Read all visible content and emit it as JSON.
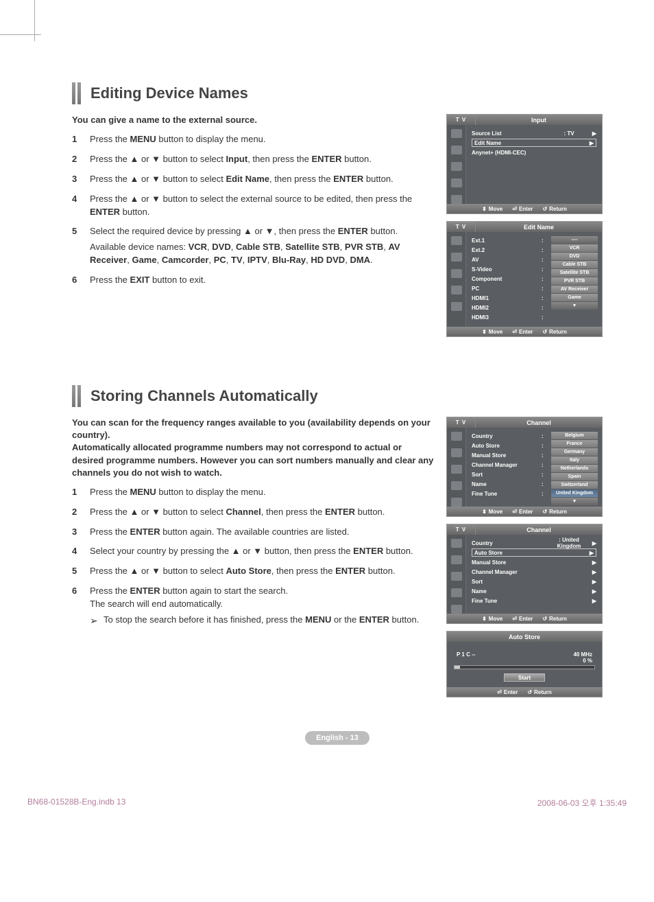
{
  "section1": {
    "title": "Editing Device Names",
    "intro": "You can give a name to the external source.",
    "steps": [
      {
        "n": "1",
        "html": "Press the <b>MENU</b> button to display the menu."
      },
      {
        "n": "2",
        "html": "Press the ▲ or ▼ button to select <b>Input</b>, then press the <b>ENTER</b> button."
      },
      {
        "n": "3",
        "html": "Press the ▲ or ▼ button to select <b>Edit Name</b>, then press the <b>ENTER</b> button."
      },
      {
        "n": "4",
        "html": "Press the ▲ or ▼ button to select the external source to be edited, then press the <b>ENTER</b> button."
      },
      {
        "n": "5",
        "html": "Select the required device by pressing ▲ or ▼, then press the <b>ENTER</b> button.",
        "sub": "Available device names: <b>VCR</b>, <b>DVD</b>, <b>Cable STB</b>, <b>Satellite STB</b>, <b>PVR STB</b>, <b>AV Receiver</b>, <b>Game</b>, <b>Camcorder</b>, <b>PC</b>, <b>TV</b>, <b>IPTV</b>, <b>Blu-Ray</b>, <b>HD DVD</b>, <b>DMA</b>."
      },
      {
        "n": "6",
        "html": "Press the <b>EXIT</b> button to exit."
      }
    ]
  },
  "section2": {
    "title": "Storing Channels Automatically",
    "intro": "You can scan for the frequency ranges available to you (availability depends on your country).\nAutomatically allocated programme numbers may not correspond to actual or desired programme numbers. However you can sort numbers manually and clear any channels you do not wish to watch.",
    "steps": [
      {
        "n": "1",
        "html": "Press the <b>MENU</b> button to display the menu."
      },
      {
        "n": "2",
        "html": "Press the ▲ or ▼ button to select <b>Channel</b>, then press the <b>ENTER</b> button."
      },
      {
        "n": "3",
        "html": "Press the <b>ENTER</b> button again. The available countries are listed."
      },
      {
        "n": "4",
        "html": "Select your country by pressing the ▲ or ▼ button, then press the <b>ENTER</b> button."
      },
      {
        "n": "5",
        "html": "Press the ▲ or ▼ button to select <b>Auto Store</b>, then press the <b>ENTER</b> button."
      },
      {
        "n": "6",
        "html": "Press the <b>ENTER</b> button again to start the search.",
        "sub2": "The search will end automatically.",
        "arrow": "To stop the search before it has finished, press the <b>MENU</b> or the <b>ENTER</b> button."
      }
    ]
  },
  "osd": {
    "tv_label": "T V",
    "foot": {
      "move": "Move",
      "enter": "Enter",
      "return": "Return"
    },
    "input_panel": {
      "title": "Input",
      "rows": [
        {
          "lab": "Source List",
          "val": ": TV",
          "arr": "▶",
          "boxed": false
        },
        {
          "lab": "Edit Name",
          "val": "",
          "arr": "▶",
          "boxed": true
        },
        {
          "lab": "Anynet+ (HDMI-CEC)",
          "val": "",
          "arr": "",
          "boxed": false
        }
      ]
    },
    "editname_panel": {
      "title": "Edit Name",
      "left": [
        "Ext.1",
        "Ext.2",
        "AV",
        "S-Video",
        "Component",
        "PC",
        "HDMI1",
        "HDMI2",
        "HDMI3"
      ],
      "tags": [
        "----",
        "VCR",
        "DVD",
        "Cable STB",
        "Satellite STB",
        "PVR STB",
        "AV Receiver",
        "Game",
        "▼"
      ]
    },
    "channel_panel1": {
      "title": "Channel",
      "left": [
        "Country",
        "Auto Store",
        "Manual Store",
        "Channel Manager",
        "Sort",
        "Name",
        "Fine Tune"
      ],
      "tags": [
        "Belgium",
        "France",
        "Germany",
        "Italy",
        "Netherlands",
        "Spain",
        "Switzerland",
        "United Kingdom",
        "▼"
      ],
      "selected_idx": 7
    },
    "channel_panel2": {
      "title": "Channel",
      "rows": [
        {
          "lab": "Country",
          "val": ": United Kingdom",
          "arr": "▶",
          "boxed": false
        },
        {
          "lab": "Auto Store",
          "val": "",
          "arr": "▶",
          "boxed": true
        },
        {
          "lab": "Manual Store",
          "val": "",
          "arr": "▶",
          "boxed": false
        },
        {
          "lab": "Channel Manager",
          "val": "",
          "arr": "▶",
          "boxed": false
        },
        {
          "lab": "Sort",
          "val": "",
          "arr": "▶",
          "boxed": false
        },
        {
          "lab": "Name",
          "val": "",
          "arr": "▶",
          "boxed": false
        },
        {
          "lab": "Fine Tune",
          "val": "",
          "arr": "▶",
          "boxed": false
        }
      ]
    },
    "autostore_panel": {
      "title": "Auto Store",
      "info_left": "P   1    C  --",
      "info_right_top": "40 MHz",
      "info_right_bot": "0 %",
      "button": "Start"
    }
  },
  "page_number": "English - 13",
  "footer": {
    "left": "BN68-01528B-Eng.indb   13",
    "right": "2008-06-03   오후 1:35:49"
  }
}
